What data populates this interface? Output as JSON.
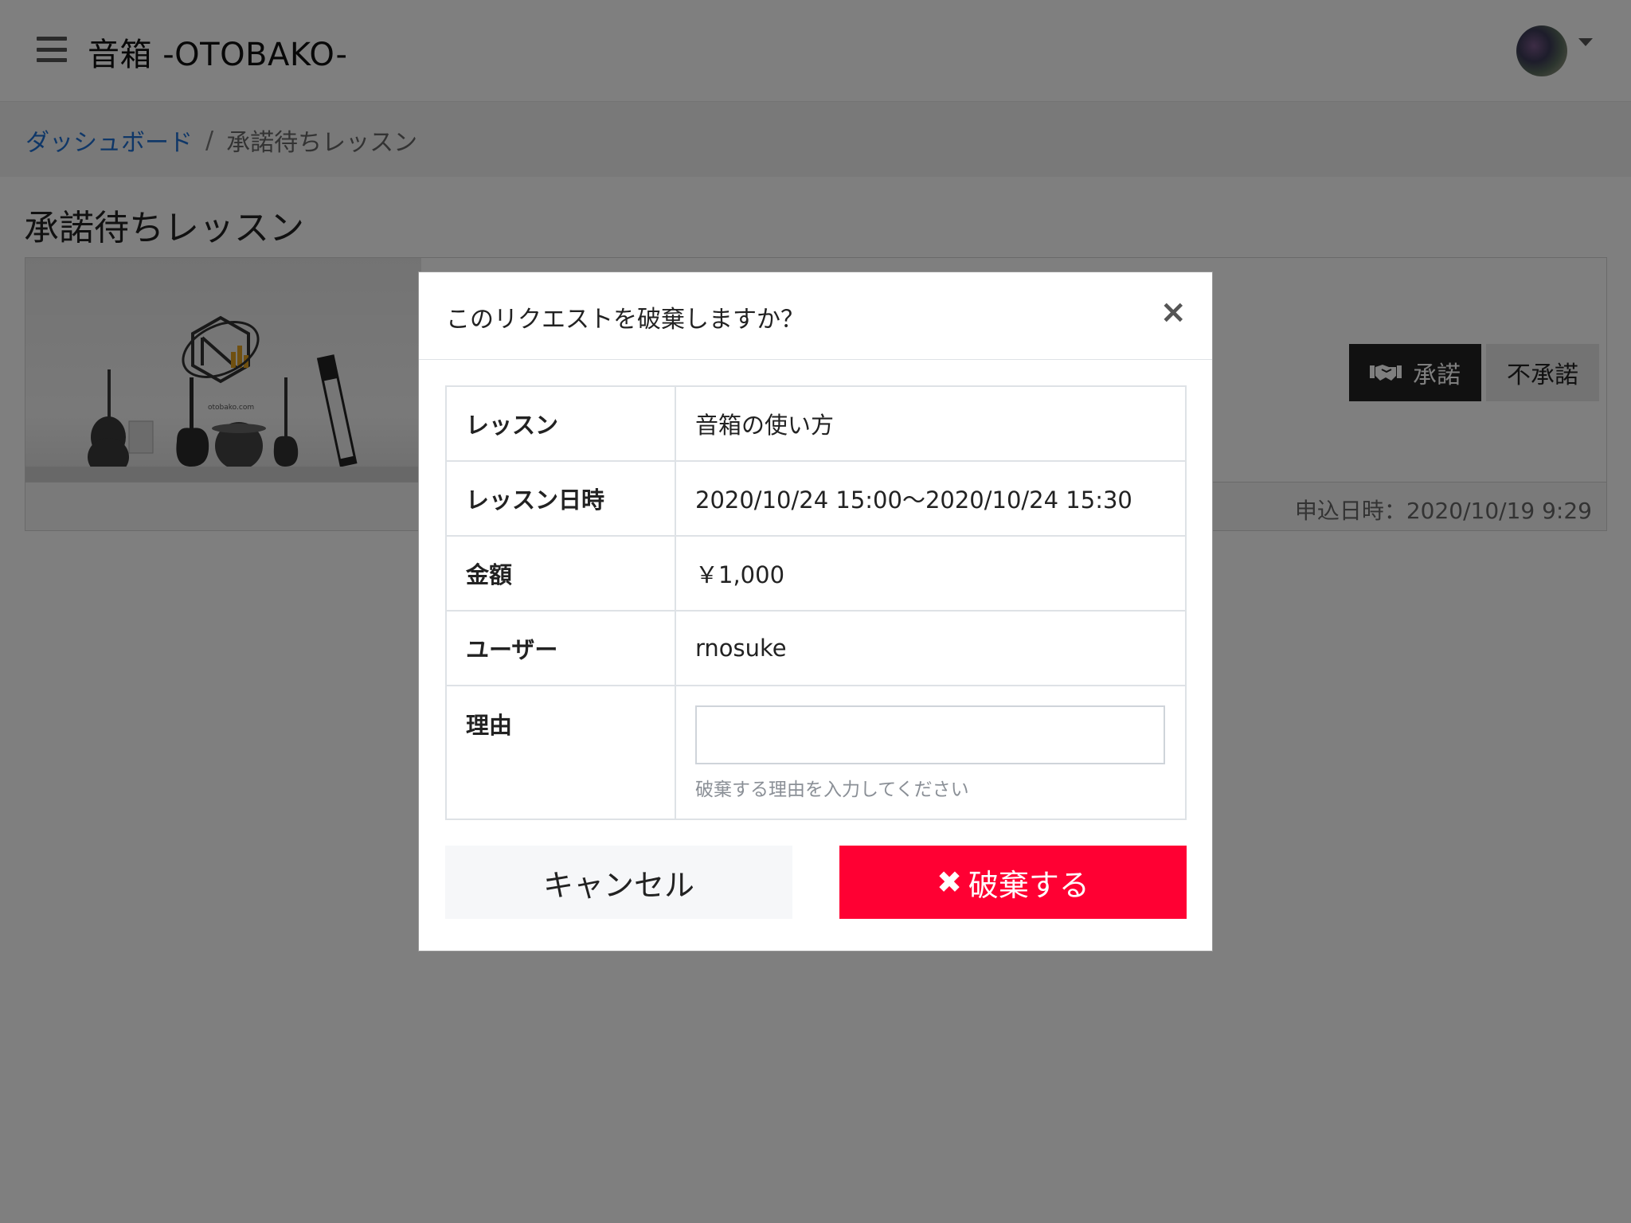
{
  "header": {
    "app_title": "音箱 -OTOBAKO-",
    "menu_icon": "hamburger-menu-icon",
    "avatar_icon": "user-avatar",
    "caret_icon": "caret-down-icon"
  },
  "breadcrumb": {
    "home_label": "ダッシュボード",
    "separator": "/",
    "current_label": "承諾待ちレッスン"
  },
  "page": {
    "title": "承諾待ちレッスン"
  },
  "card": {
    "image_logo_text": "otobako.com",
    "accept_label": "承諾",
    "accept_icon": "handshake-icon",
    "reject_label": "不承諾",
    "applied_date": "申込日時：2020/10/19 9:29"
  },
  "modal": {
    "title": "このリクエストを破棄しますか？",
    "close_symbol": "×",
    "rows": [
      {
        "label": "レッスン",
        "value": "音箱の使い方"
      },
      {
        "label": "レッスン日時",
        "value": "2020/10/24 15:00〜2020/10/24 15:30"
      },
      {
        "label": "金額",
        "value": "￥1,000"
      },
      {
        "label": "ユーザー",
        "value": "rnosuke"
      }
    ],
    "reason_label": "理由",
    "reason_value": "",
    "reason_hint": "破棄する理由を入力してください",
    "cancel_label": "キャンセル",
    "discard_label": "破棄する",
    "discard_icon_symbol": "✖"
  },
  "colors": {
    "discard_button": "#ff0033",
    "accept_button": "#222222",
    "link": "#1f6fd1"
  }
}
